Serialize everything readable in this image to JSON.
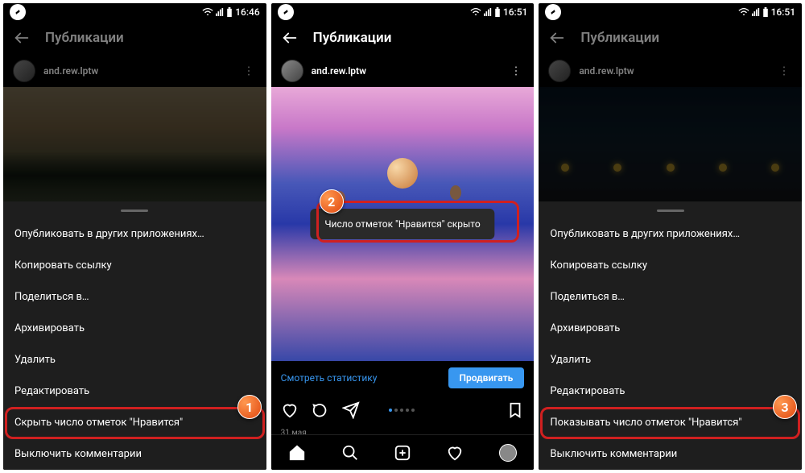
{
  "status": {
    "time1": "16:46",
    "time2": "16:51",
    "time3": "16:51"
  },
  "header": {
    "title": "Публикации"
  },
  "user": {
    "name": "and.rew.lptw"
  },
  "menu": {
    "publish": "Опубликовать в других приложениях…",
    "copy": "Копировать ссылку",
    "share": "Поделиться в…",
    "archive": "Архивировать",
    "delete": "Удалить",
    "edit": "Редактировать",
    "hide_likes": "Скрыть число отметок \"Нравится\"",
    "show_likes": "Показывать число отметок \"Нравится\"",
    "disable_comments": "Выключить комментарии"
  },
  "toast": {
    "hidden": "Число отметок \"Нравится\" скрыто"
  },
  "stats": {
    "link": "Смотреть статистику",
    "promote": "Продвигать"
  },
  "date": "31 мая",
  "badges": {
    "b1": "1",
    "b2": "2",
    "b3": "3"
  }
}
